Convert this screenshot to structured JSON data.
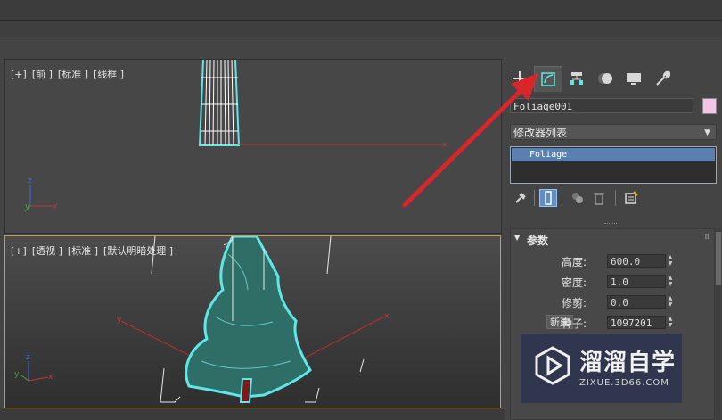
{
  "viewport_front": {
    "labels": [
      "[+]",
      "[前 ]",
      "[标准 ]",
      "[线框 ]"
    ]
  },
  "viewport_persp": {
    "labels": [
      "[+]",
      "[透视 ]",
      "[标准 ]",
      "[默认明暗处理 ]"
    ]
  },
  "axes": {
    "x": "x",
    "y": "y",
    "z": "z"
  },
  "command_panel": {
    "tabs": [
      {
        "name": "create-tab",
        "icon": "plus-icon"
      },
      {
        "name": "modify-tab",
        "icon": "modify-icon",
        "active": true
      },
      {
        "name": "hierarchy-tab",
        "icon": "hierarchy-icon"
      },
      {
        "name": "motion-tab",
        "icon": "motion-icon"
      },
      {
        "name": "display-tab",
        "icon": "display-icon"
      },
      {
        "name": "utilities-tab",
        "icon": "wrench-icon"
      }
    ],
    "object_name": "Foliage001",
    "object_color": "#f3c6e8",
    "modifier_list_label": "修改器列表",
    "stack_items": [
      "Foliage"
    ],
    "stack_tools": [
      "pin-icon",
      "show-end-result-icon",
      "make-unique-icon",
      "remove-modifier-icon",
      "configure-modifier-sets-icon"
    ]
  },
  "parameters": {
    "title": "参数",
    "height_label": "高度:",
    "height_value": "600.0",
    "density_label": "密度:",
    "density_value": "1.0",
    "prune_label": "修剪:",
    "prune_value": "0.0",
    "new_button": "新建",
    "seed_label": "种子:",
    "seed_value": "1097201"
  },
  "watermark": {
    "title": "溜溜自学",
    "url": "ZIXUE.3D66.COM"
  },
  "colors": {
    "selection_cyan": "#5fe6e6",
    "active_viewport_border": "#c7a042",
    "annotation_arrow": "#d8262b",
    "modifier_highlight": "#5a7fb0"
  }
}
